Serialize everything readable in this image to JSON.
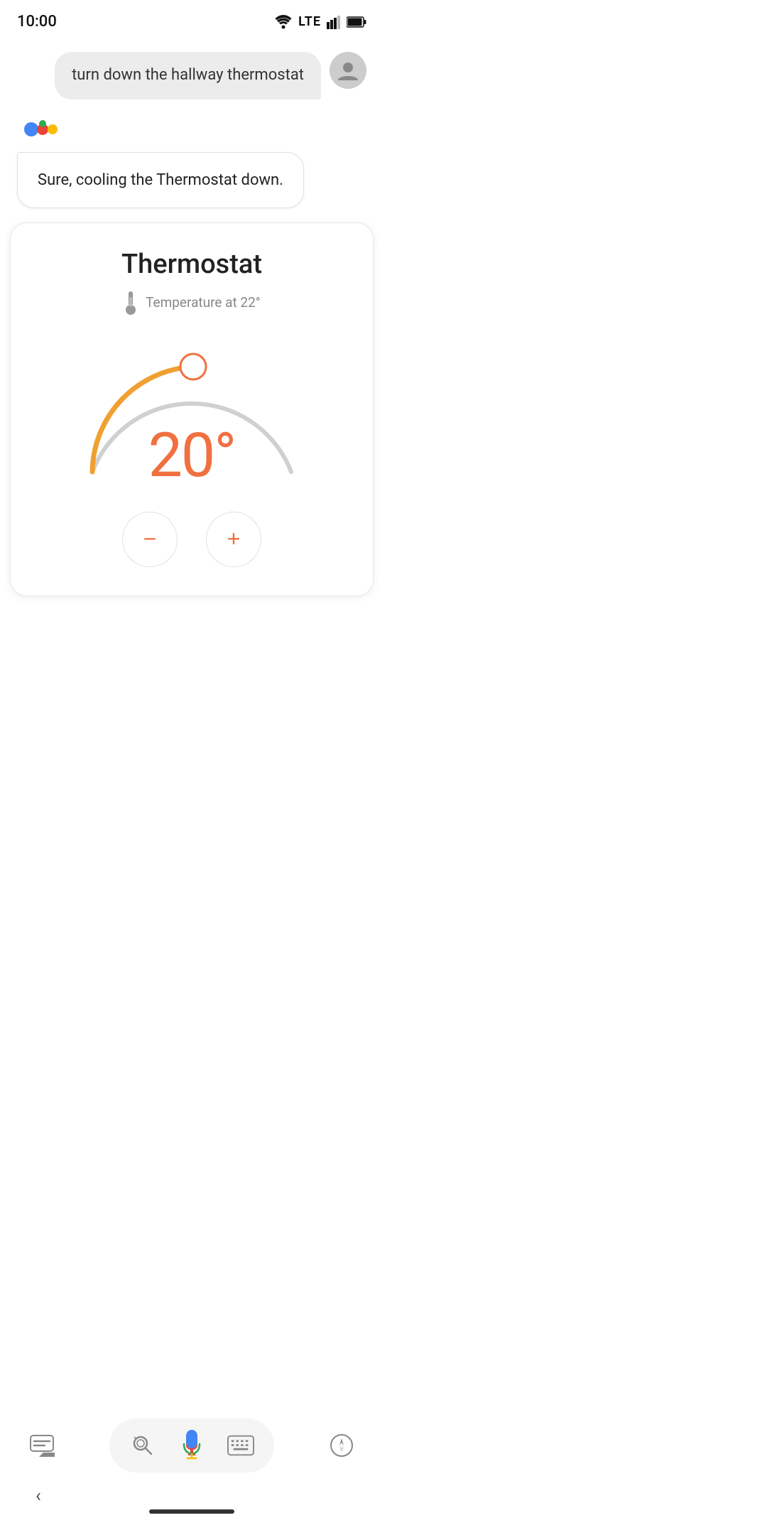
{
  "statusBar": {
    "time": "10:00"
  },
  "chat": {
    "userMessage": "turn down the hallway thermostat",
    "assistantMessage": "Sure, cooling the Thermostat down."
  },
  "thermostat": {
    "title": "Thermostat",
    "tempLabel": "Temperature at 22°",
    "currentTemp": "20°",
    "dialMin": 10,
    "dialMax": 30,
    "dialValue": 20,
    "accentColor": "#f07040",
    "trackColor": "#cccccc",
    "decreaseLabel": "−",
    "increaseLabel": "+"
  },
  "toolbar": {
    "lensIconLabel": "lens-icon",
    "micIconLabel": "mic-icon",
    "keyboardIconLabel": "keyboard-icon",
    "compassIconLabel": "compass-icon",
    "assistantIconLabel": "assistant-icon"
  }
}
